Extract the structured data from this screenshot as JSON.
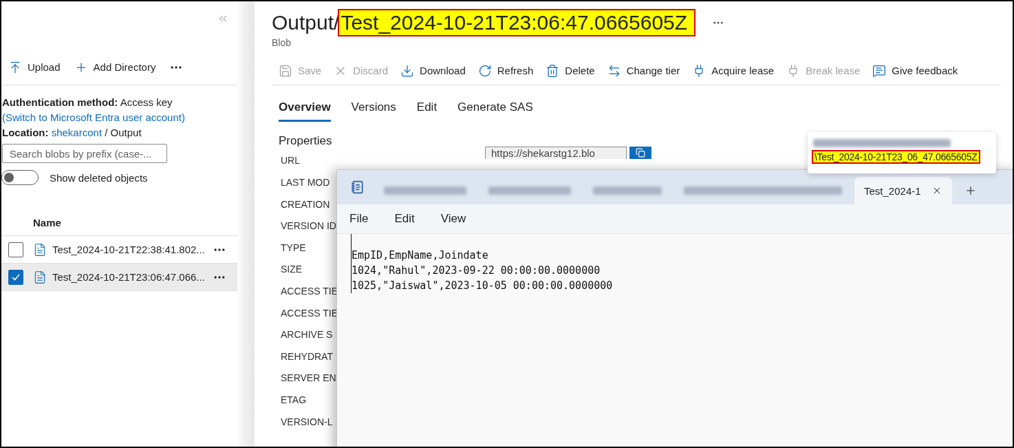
{
  "sidebar": {
    "toolbar": [
      {
        "kind": "upload",
        "label": "Upload"
      },
      {
        "kind": "add",
        "label": "Add Directory"
      }
    ],
    "auth": {
      "label": "Authentication method:",
      "value": "Access key",
      "link": "(Switch to Microsoft Entra user account)"
    },
    "location": {
      "label": "Location:",
      "link": "shekarcont",
      "separator": "/",
      "value": "Output"
    },
    "search": {
      "placeholder": "Search blobs by prefix (case-..."
    },
    "toggle": {
      "label": "Show deleted objects",
      "on": false
    },
    "list": {
      "header": "Name",
      "rows": [
        {
          "name": "Test_2024-10-21T22:38:41.802...",
          "selected": false
        },
        {
          "name": "Test_2024-10-21T23:06:47.066...",
          "selected": true
        }
      ]
    }
  },
  "main": {
    "title_parts": [
      {
        "text": "Output/",
        "highlighted": false
      },
      {
        "text": "Test_2024-10-21T23:06:47.0665605Z",
        "highlighted": true
      }
    ],
    "subtitle": "Blob",
    "toolbar": [
      {
        "kind": "save",
        "label": "Save",
        "disabled": true
      },
      {
        "kind": "discard",
        "label": "Discard",
        "disabled": true
      },
      {
        "kind": "download",
        "label": "Download",
        "disabled": false
      },
      {
        "kind": "refresh",
        "label": "Refresh",
        "disabled": false
      },
      {
        "kind": "delete",
        "label": "Delete",
        "disabled": false
      },
      {
        "kind": "tier",
        "label": "Change tier",
        "disabled": false
      },
      {
        "kind": "acquire",
        "label": "Acquire lease",
        "disabled": false
      },
      {
        "kind": "break",
        "label": "Break lease",
        "disabled": true
      },
      {
        "kind": "feedback",
        "label": "Give feedback",
        "disabled": false
      }
    ],
    "tabs": [
      {
        "label": "Overview",
        "selected": true
      },
      {
        "label": "Versions",
        "selected": false
      },
      {
        "label": "Edit",
        "selected": false
      },
      {
        "label": "Generate SAS",
        "selected": false
      }
    ],
    "section": "Properties",
    "url": {
      "label": "URL",
      "value": "https://shekarstg12.blo"
    },
    "properties": [
      "LAST MOD",
      "CREATION",
      "VERSION ID",
      "TYPE",
      "SIZE",
      "ACCESS TIE",
      "ACCESS TIE",
      "ARCHIVE S",
      "REHYDRAT",
      "SERVER EN",
      "ETAG",
      "VERSION-L"
    ]
  },
  "tooltip": {
    "path": "\\Test_2024-10-21T23_06_47.0665605Z",
    "highlighted": true
  },
  "notepad": {
    "tabs": [
      {
        "kind": "blurred",
        "selected": false
      },
      {
        "kind": "blurred",
        "selected": false
      },
      {
        "kind": "blurred",
        "selected": false
      },
      {
        "kind": "blurred",
        "selected": false
      },
      {
        "kind": "named",
        "label": "Test_2024-1",
        "selected": true
      }
    ],
    "menu": [
      "File",
      "Edit",
      "View"
    ],
    "lines": [
      "EmpID,EmpName,Joindate",
      "1024,\"Rahul\",2023-09-22 00:00:00.0000000",
      "1025,\"Jaiswal\",2023-10-05 00:00:00.0000000"
    ]
  }
}
